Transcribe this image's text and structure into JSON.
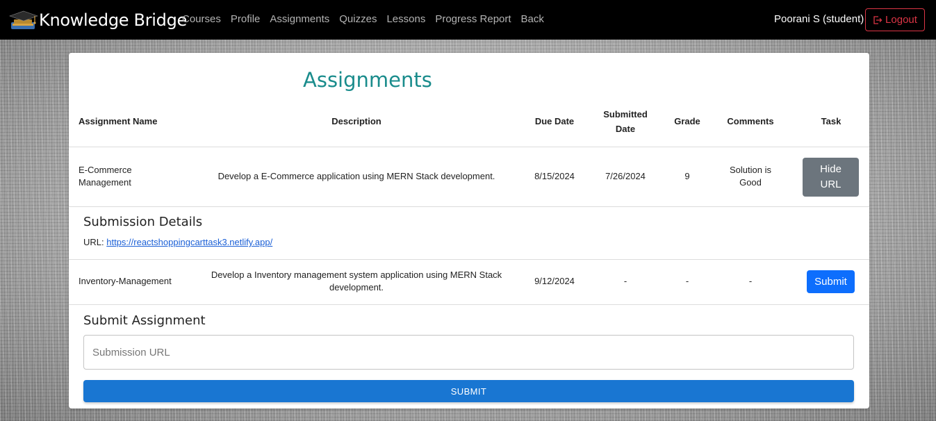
{
  "navbar": {
    "brand": "Knowledge Bridge",
    "links": [
      "Courses",
      "Profile",
      "Assignments",
      "Quizzes",
      "Lessons",
      "Progress Report",
      "Back"
    ],
    "user": "Poorani S (student)",
    "logout": "Logout"
  },
  "page": {
    "title": "Assignments"
  },
  "table": {
    "headers": {
      "name": "Assignment Name",
      "description": "Description",
      "due": "Due Date",
      "submitted_line1": "Submitted",
      "submitted_line2": "Date",
      "grade": "Grade",
      "comments": "Comments",
      "task": "Task"
    },
    "rows": [
      {
        "name_line1": "E-Commerce",
        "name_line2": "Management",
        "description": "Develop a E-Commerce application using MERN Stack development.",
        "due": "8/15/2024",
        "submitted": "7/26/2024",
        "grade": "9",
        "comments_line1": "Solution is",
        "comments_line2": "Good",
        "action_line1": "Hide",
        "action_line2": "URL"
      },
      {
        "name": "Inventory-Management",
        "description_line1": "Develop a Inventory management system application using MERN Stack",
        "description_line2": "development.",
        "due": "9/12/2024",
        "submitted": "-",
        "grade": "-",
        "comments": "-",
        "action": "Submit"
      }
    ]
  },
  "submission_details": {
    "title": "Submission Details",
    "url_label": "URL:",
    "url": "https://reactshoppingcarttask3.netlify.app/"
  },
  "submit_assignment": {
    "title": "Submit Assignment",
    "placeholder": "Submission URL",
    "button": "SUBMIT"
  },
  "colors": {
    "title": "#1a8c8c",
    "primary": "#0d6efd",
    "secondary": "#6c757d",
    "danger": "#dc3545",
    "mui_primary": "#1976d2"
  }
}
